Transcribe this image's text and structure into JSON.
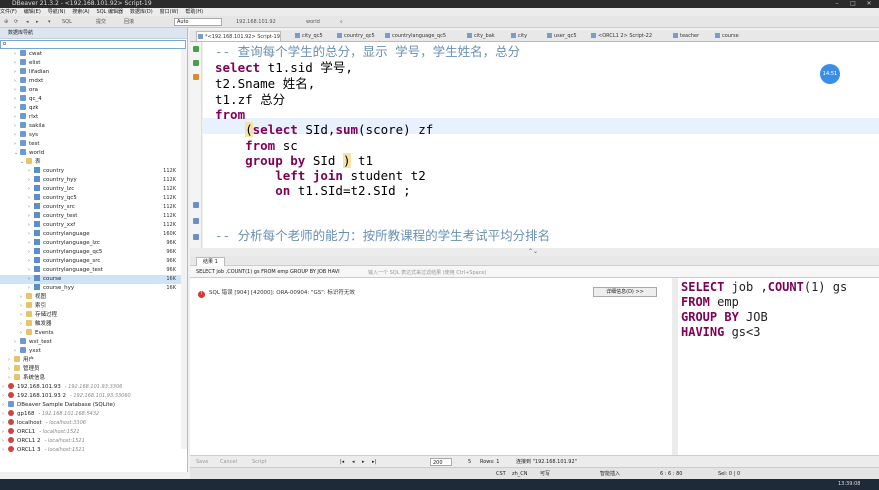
{
  "window": {
    "title": "DBeaver 21.3.2 - <192.168.101.92> Script-19"
  },
  "menu": [
    "文件(F)",
    "编辑(E)",
    "导航(N)",
    "搜索(A)",
    "SQL 编辑器",
    "数据库(D)",
    "窗口(W)",
    "帮助(H)"
  ],
  "toolbar": {
    "sql_label": "SQL",
    "submit_label": "提交",
    "rollback_label": "回滚",
    "tx_mode": "Auto",
    "connection": "192.168.101.92",
    "database": "world"
  },
  "nav": {
    "title": "数据库导航",
    "search_value": "o",
    "rows": [
      {
        "label": "cwat",
        "depth": 2,
        "icon": "db",
        "arrow": "›"
      },
      {
        "label": "elist",
        "depth": 2,
        "icon": "db",
        "arrow": "›"
      },
      {
        "label": "lifadian",
        "depth": 2,
        "icon": "db",
        "arrow": "›"
      },
      {
        "label": "mdxt",
        "depth": 2,
        "icon": "db",
        "arrow": "›"
      },
      {
        "label": "ora",
        "depth": 2,
        "icon": "db",
        "arrow": "›"
      },
      {
        "label": "qc_4",
        "depth": 2,
        "icon": "db",
        "arrow": "›"
      },
      {
        "label": "qzk",
        "depth": 2,
        "icon": "db",
        "arrow": "›"
      },
      {
        "label": "rlxt",
        "depth": 2,
        "icon": "db",
        "arrow": "›"
      },
      {
        "label": "sakila",
        "depth": 2,
        "icon": "db",
        "arrow": "›"
      },
      {
        "label": "sys",
        "depth": 2,
        "icon": "db",
        "arrow": "›"
      },
      {
        "label": "test",
        "depth": 2,
        "icon": "db",
        "arrow": "›"
      },
      {
        "label": "world",
        "depth": 2,
        "icon": "db",
        "arrow": "⌄"
      },
      {
        "label": "表",
        "depth": 3,
        "icon": "folder",
        "arrow": "⌄"
      },
      {
        "label": "country",
        "depth": 4,
        "icon": "table",
        "arrow": "›",
        "size": "112K"
      },
      {
        "label": "country_hyy",
        "depth": 4,
        "icon": "table",
        "arrow": "›",
        "size": "112K"
      },
      {
        "label": "country_lzc",
        "depth": 4,
        "icon": "table",
        "arrow": "›",
        "size": "112K"
      },
      {
        "label": "country_qc5",
        "depth": 4,
        "icon": "table",
        "arrow": "›",
        "size": "112K"
      },
      {
        "label": "country_src",
        "depth": 4,
        "icon": "table",
        "arrow": "›",
        "size": "112K"
      },
      {
        "label": "country_test",
        "depth": 4,
        "icon": "table",
        "arrow": "›",
        "size": "112K"
      },
      {
        "label": "country_xxf",
        "depth": 4,
        "icon": "table",
        "arrow": "›",
        "size": "112K"
      },
      {
        "label": "countrylanguage",
        "depth": 4,
        "icon": "table",
        "arrow": "›",
        "size": "160K"
      },
      {
        "label": "countrylanguage_lzc",
        "depth": 4,
        "icon": "table",
        "arrow": "›",
        "size": "96K"
      },
      {
        "label": "countrylanguage_qc5",
        "depth": 4,
        "icon": "table",
        "arrow": "›",
        "size": "96K"
      },
      {
        "label": "countrylanguage_src",
        "depth": 4,
        "icon": "table",
        "arrow": "›",
        "size": "96K"
      },
      {
        "label": "countrylanguage_test",
        "depth": 4,
        "icon": "table",
        "arrow": "›",
        "size": "96K"
      },
      {
        "label": "course",
        "depth": 4,
        "icon": "table",
        "arrow": "›",
        "size": "16K",
        "selected": true
      },
      {
        "label": "course_hyy",
        "depth": 4,
        "icon": "table",
        "arrow": "›",
        "size": "16K"
      },
      {
        "label": "视图",
        "depth": 3,
        "icon": "folder",
        "arrow": "›"
      },
      {
        "label": "索引",
        "depth": 3,
        "icon": "folder",
        "arrow": "›"
      },
      {
        "label": "存储过程",
        "depth": 3,
        "icon": "folder",
        "arrow": "›"
      },
      {
        "label": "触发器",
        "depth": 3,
        "icon": "folder",
        "arrow": "›"
      },
      {
        "label": "Events",
        "depth": 3,
        "icon": "folder",
        "arrow": "›"
      },
      {
        "label": "wst_test",
        "depth": 2,
        "icon": "db",
        "arrow": "›"
      },
      {
        "label": "yxxt",
        "depth": 2,
        "icon": "db",
        "arrow": "›"
      },
      {
        "label": "用户",
        "depth": 1,
        "icon": "folder",
        "arrow": "›"
      },
      {
        "label": "管理员",
        "depth": 1,
        "icon": "folder",
        "arrow": "›"
      },
      {
        "label": "系统信息",
        "depth": 1,
        "icon": "folder",
        "arrow": "›"
      },
      {
        "label": "192.168.101.93",
        "depth": 0,
        "icon": "conn",
        "arrow": "›",
        "sub": "- 192.168.101.93:3306"
      },
      {
        "label": "192.168.101.93 2",
        "depth": 0,
        "icon": "conn",
        "arrow": "›",
        "sub": "- 192.168.101.93:33060"
      },
      {
        "label": "DBeaver Sample Database (SQLite)",
        "depth": 0,
        "icon": "db",
        "arrow": "›"
      },
      {
        "label": "gp168",
        "depth": 0,
        "icon": "conn",
        "arrow": "›",
        "sub": "- 192.168.101.168:5432"
      },
      {
        "label": "localhost",
        "depth": 0,
        "icon": "conn",
        "arrow": "›",
        "sub": "- localhost:3306"
      },
      {
        "label": "ORCL1",
        "depth": 0,
        "icon": "conn",
        "arrow": "›",
        "sub": "- localhost:1521"
      },
      {
        "label": "ORCL1 2",
        "depth": 0,
        "icon": "conn",
        "arrow": "›",
        "sub": "- localhost:1521"
      },
      {
        "label": "ORCL1 3",
        "depth": 0,
        "icon": "conn",
        "arrow": "›",
        "sub": "- localhost:1521"
      }
    ]
  },
  "tabs": [
    {
      "label": "*<192.168.101.92> Script-19",
      "active": true
    },
    {
      "label": "city_qc5"
    },
    {
      "label": "country_qc5"
    },
    {
      "label": "countrylanguage_qc5"
    },
    {
      "label": "city_bak"
    },
    {
      "label": "city"
    },
    {
      "label": "user_qc5"
    },
    {
      "label": "<ORCL1 2> Script-22"
    },
    {
      "label": "teacher"
    },
    {
      "label": "course"
    }
  ],
  "editor": {
    "comment1": "-- 查询每个学生的总分，显示 学号，学生姓名，总分",
    "comment2": "-- 分析每个老师的能力：按所教课程的学生考试平均分排名",
    "time_badge": "14:51"
  },
  "results": {
    "tab_label": "结果 1",
    "query_preview": "SELECT job ,COUNT(1) gs FROM emp GROUP BY JOB HAVI",
    "filter_placeholder": "输入一个 SQL 表达式来过滤结果 (使用 Ctrl+Space)",
    "error_text": "SQL 错误 [904] [42000]: ORA-00904: \"GS\": 标识符无效",
    "detail_button": "详细信息(D) >>",
    "side_sql": [
      "SELECT job ,COUNT(1) gs",
      "FROM emp",
      "GROUP BY JOB",
      "HAVING gs<3"
    ]
  },
  "bottom": {
    "save": "Save",
    "cancel": "Cancel",
    "script": "Script",
    "fetch_size": "200",
    "fetch_count": "5",
    "rows": "Rows: 1",
    "connection_status": "连接到 \"192.168.101.92\""
  },
  "status": {
    "encoding": "CST",
    "locale": "zh_CN",
    "mode": "可写",
    "insert": "智能插入",
    "position": "6 : 6 : 80",
    "selection": "Sel: 0 | 0",
    "clock": "13:39:08"
  }
}
